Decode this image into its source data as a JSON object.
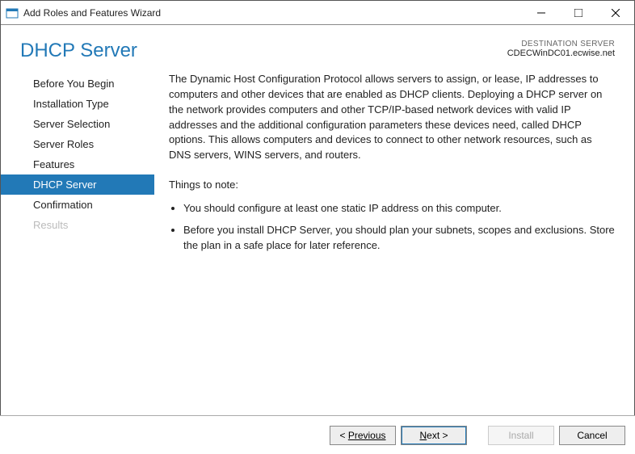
{
  "window": {
    "title": "Add Roles and Features Wizard"
  },
  "header": {
    "title": "DHCP Server",
    "destination_label": "DESTINATION SERVER",
    "destination_value": "CDECWinDC01.ecwise.net"
  },
  "nav": {
    "items": [
      {
        "label": "Before You Begin",
        "selected": false,
        "disabled": false
      },
      {
        "label": "Installation Type",
        "selected": false,
        "disabled": false
      },
      {
        "label": "Server Selection",
        "selected": false,
        "disabled": false
      },
      {
        "label": "Server Roles",
        "selected": false,
        "disabled": false
      },
      {
        "label": "Features",
        "selected": false,
        "disabled": false
      },
      {
        "label": "DHCP Server",
        "selected": true,
        "disabled": false
      },
      {
        "label": "Confirmation",
        "selected": false,
        "disabled": false
      },
      {
        "label": "Results",
        "selected": false,
        "disabled": true
      }
    ]
  },
  "main": {
    "intro": "The Dynamic Host Configuration Protocol allows servers to assign, or lease, IP addresses to computers and other devices that are enabled as DHCP clients. Deploying a DHCP server on the network provides computers and other TCP/IP-based network devices with valid IP addresses and the additional configuration parameters these devices need, called DHCP options. This allows computers and devices to connect to other network resources, such as DNS servers, WINS servers, and routers.",
    "note_heading": "Things to note:",
    "notes": [
      "You should configure at least one static IP address on this computer.",
      "Before you install DHCP Server, you should plan your subnets, scopes and exclusions. Store the plan in a safe place for later reference."
    ]
  },
  "footer": {
    "previous": "Previous",
    "next": "Next >",
    "install": "Install",
    "cancel": "Cancel"
  }
}
